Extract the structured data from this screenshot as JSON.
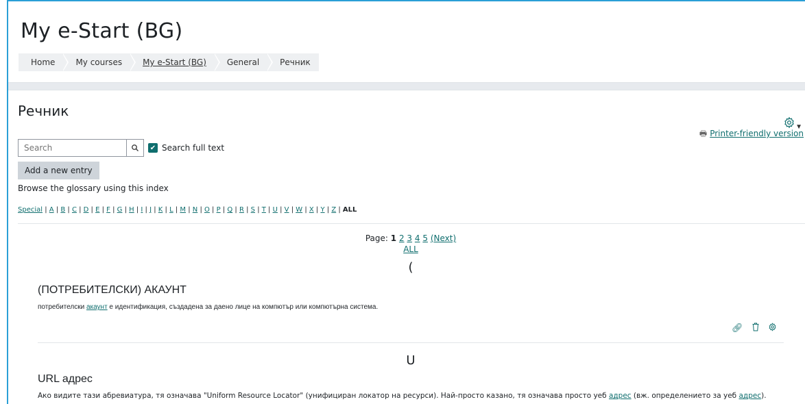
{
  "header": {
    "site_title": "My e-Start (BG)",
    "breadcrumb": [
      "Home",
      "My courses",
      "My e-Start (BG)",
      "General",
      "Речник"
    ]
  },
  "main": {
    "heading": "Речник",
    "printer_link": "Printer-friendly version",
    "search": {
      "placeholder": "Search",
      "value": "",
      "fulltext_label": "Search full text",
      "fulltext_checked": true
    },
    "add_entry_label": "Add a new entry",
    "browse_text": "Browse the glossary using this index",
    "alphabet": [
      "Special",
      "A",
      "B",
      "C",
      "D",
      "E",
      "F",
      "G",
      "H",
      "I",
      "J",
      "K",
      "L",
      "M",
      "N",
      "O",
      "P",
      "Q",
      "R",
      "S",
      "T",
      "U",
      "V",
      "W",
      "X",
      "Y",
      "Z"
    ],
    "alphabet_current": "ALL",
    "paging": {
      "label": "Page:",
      "current": "1",
      "pages": [
        "2",
        "3",
        "4",
        "5"
      ],
      "next": "(Next)",
      "all": "ALL"
    },
    "sections": [
      {
        "letter": "(",
        "entries": [
          {
            "title": "(ПОТРЕБИТЕЛСКИ) АКАУНТ",
            "def_pre": "потребителски ",
            "def_link": "акаунт",
            "def_post": " е идентификация, създадена за даено лице на компютър или компютърна система."
          }
        ]
      },
      {
        "letter": "U",
        "entries": [
          {
            "title": "URL адрес",
            "def_pre": "Ако видите тази абревиатура, тя означава \"Uniform Resource Locator\" (унифициран локатор на ресурси). Най-просто казано, тя означава просто уеб ",
            "def_link": "адрес",
            "def_mid": " (вж. определението за уеб ",
            "def_link2": "адрес",
            "def_post": ")."
          }
        ]
      }
    ],
    "icons": [
      "link-icon",
      "trash-icon",
      "gear-icon"
    ]
  },
  "colors": {
    "accent": "#0f6e6e",
    "frame": "#2a9fd6",
    "breadcrumb_bg": "#eef0f2",
    "button_bg": "#ced4da"
  }
}
